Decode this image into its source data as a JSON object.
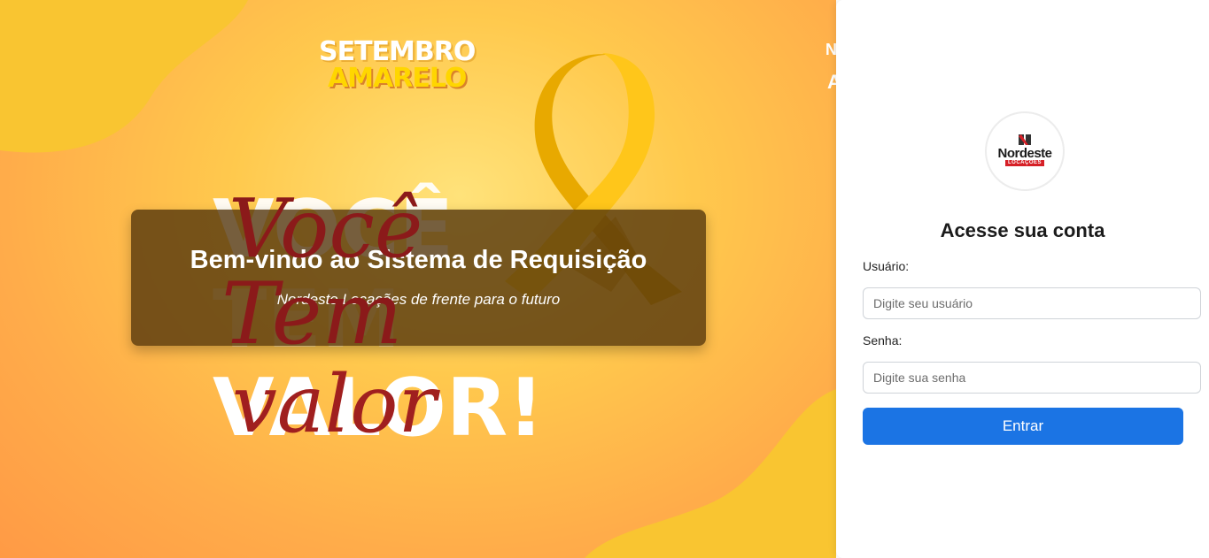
{
  "hero": {
    "campaign_line1": "SETEMBRO",
    "campaign_line2": "AMARELO",
    "poster_big_words": [
      "VOCÊ",
      "TEM",
      "VALOR!"
    ],
    "poster_script_words": [
      "Você",
      "Tem",
      "valor"
    ],
    "welcome_title": "Bem-vindo ao Sistema de Requisição",
    "welcome_subtitle": "Nordeste Locações de frente para o futuro"
  },
  "login": {
    "logo_name": "Nordeste",
    "logo_sub": "LOCAÇÕES",
    "heading": "Acesse sua conta",
    "username_label": "Usuário:",
    "username_placeholder": "Digite seu usuário",
    "password_label": "Senha:",
    "password_placeholder": "Digite sua senha",
    "submit_label": "Entrar"
  },
  "colors": {
    "accent_button": "#1b74e4",
    "campaign_yellow": "#ffd600",
    "script_red": "#8b1a1a",
    "logo_red": "#d62027"
  }
}
